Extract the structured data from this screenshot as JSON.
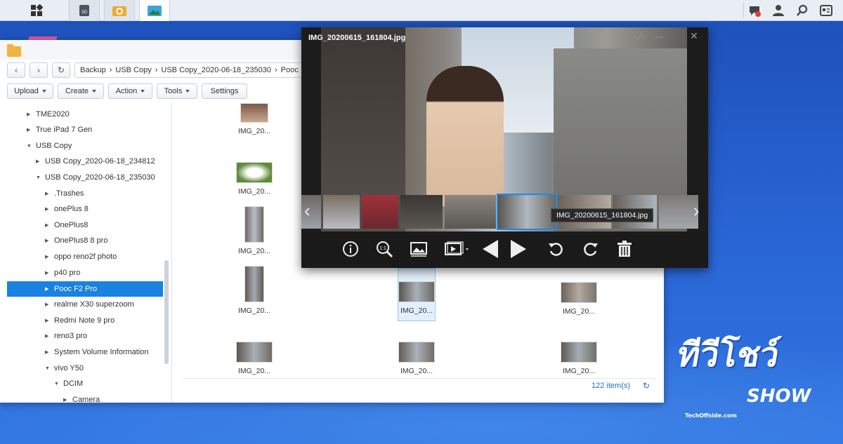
{
  "viewer": {
    "title": "IMG_20200615_161804.jpg",
    "tooltip": "IMG_20200615_161804.jpg",
    "icons": [
      "info-icon",
      "zoom-actual-size-icon",
      "image-icon",
      "slideshow-icon",
      "previous-icon",
      "next-icon",
      "rotate-left-icon",
      "rotate-right-icon",
      "delete-icon"
    ]
  },
  "filestation": {
    "path": [
      "Backup",
      "USB Copy",
      "USB Copy_2020-06-18_235030",
      "Pooc"
    ],
    "toolbar": {
      "upload": "Upload",
      "create": "Create",
      "action": "Action",
      "tools": "Tools",
      "settings": "Settings"
    },
    "tree": [
      {
        "label": "TME2020",
        "indent": 0,
        "open": false
      },
      {
        "label": "True iPad 7 Gen",
        "indent": 0,
        "open": false
      },
      {
        "label": "USB Copy",
        "indent": 0,
        "open": true
      },
      {
        "label": "USB Copy_2020-06-18_234812",
        "indent": 1,
        "open": false
      },
      {
        "label": "USB Copy_2020-06-18_235030",
        "indent": 1,
        "open": true
      },
      {
        "label": ".Trashes",
        "indent": 2,
        "open": false
      },
      {
        "label": "onePlus 8",
        "indent": 2,
        "open": false
      },
      {
        "label": "OnePlus8",
        "indent": 2,
        "open": false
      },
      {
        "label": "OnePlus8 8 pro",
        "indent": 2,
        "open": false
      },
      {
        "label": "oppo reno2f photo",
        "indent": 2,
        "open": false
      },
      {
        "label": "p40 pro",
        "indent": 2,
        "open": false
      },
      {
        "label": "Pooc F2 Pro",
        "indent": 2,
        "open": false,
        "selected": true
      },
      {
        "label": "realme X30 superzoom",
        "indent": 2,
        "open": false
      },
      {
        "label": "Redmi Note 9 pro",
        "indent": 2,
        "open": false
      },
      {
        "label": "reno3 pro",
        "indent": 2,
        "open": false
      },
      {
        "label": "System Volume Information",
        "indent": 2,
        "open": false
      },
      {
        "label": "vivo Y50",
        "indent": 2,
        "open": true
      },
      {
        "label": "DCIM",
        "indent": 3,
        "open": true
      },
      {
        "label": "Camera",
        "indent": 4,
        "open": false
      }
    ],
    "file_label": "IMG_20...",
    "item_count": "122 item(s)"
  },
  "watermark": {
    "line1": "ทีวีโชว์",
    "line2": "SHOW",
    "site": "TechOffside.com"
  },
  "colors": {
    "accent": "#1a82e0",
    "desktop": "#2a66d6"
  }
}
